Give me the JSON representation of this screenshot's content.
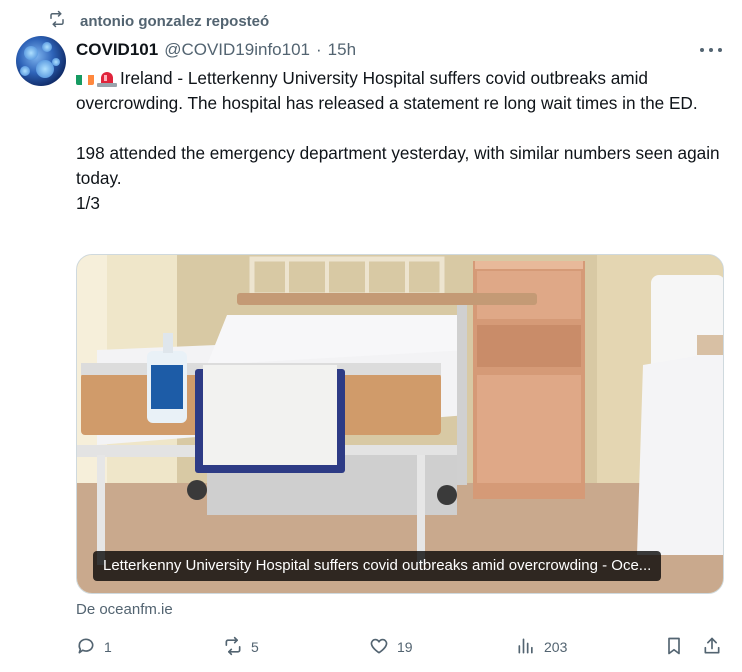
{
  "repost": {
    "text": "antonio gonzalez reposteó",
    "icon": "repost-icon"
  },
  "tweet": {
    "author_name": "COVID101",
    "handle": "@COVID19info101",
    "separator": "·",
    "time": "15h",
    "lines": [
      "Ireland - Letterkenny University Hospital suffers covid outbreaks amid overcrowding. The hospital has released a statement re long wait times in the ED.",
      "198 attended the emergency department yesterday, with similar numbers seen again today.",
      "1/3"
    ],
    "emojis": [
      "irish-flag-emoji",
      "siren-emoji"
    ]
  },
  "card": {
    "caption": "Letterkenny University Hospital suffers covid outbreaks amid overcrowding - Oce...",
    "source": "De oceanfm.ie",
    "image_subject": "hospital bed with overbed table and bedside cabinet"
  },
  "actions": {
    "replies": "1",
    "reposts": "5",
    "likes": "19",
    "views": "203"
  },
  "colors": {
    "text": "#0f1419",
    "secondary": "#536471",
    "border": "#cfd9de"
  }
}
